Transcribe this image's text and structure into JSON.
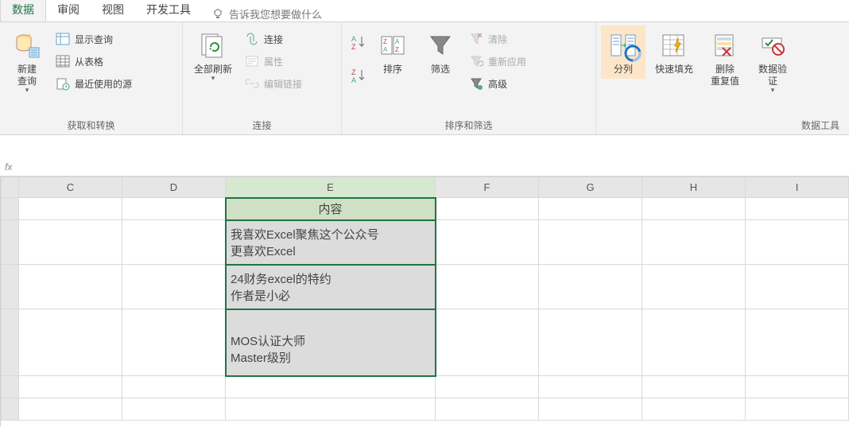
{
  "tabs": {
    "active": "数据",
    "items": [
      "数据",
      "审阅",
      "视图",
      "开发工具"
    ],
    "tellme": "告诉我您想要做什么"
  },
  "ribbon": {
    "group_get": {
      "label": "获取和转换",
      "new_query": "新建\n查询",
      "show_query": "显示查询",
      "from_table": "从表格",
      "recent": "最近使用的源"
    },
    "group_conn": {
      "label": "连接",
      "refresh_all": "全部刷新",
      "connections": "连接",
      "properties": "属性",
      "edit_links": "编辑链接"
    },
    "group_sort": {
      "label": "排序和筛选",
      "sort": "排序",
      "filter": "筛选",
      "clear": "清除",
      "reapply": "重新应用",
      "advanced": "高级"
    },
    "group_tools": {
      "label": "数据工具",
      "text_to_cols": "分列",
      "flash_fill": "快速填充",
      "remove_dup": "删除\n重复值",
      "data_valid": "数据验\n证"
    }
  },
  "grid": {
    "columns": [
      "C",
      "D",
      "E",
      "F",
      "G",
      "H",
      "I"
    ],
    "e_header": "内容",
    "e_rows": [
      "我喜欢Excel聚焦这个公众号\n更喜欢Excel",
      "24财务excel的特约\n作者是小必",
      "\nMOS认证大师\nMaster级别"
    ]
  }
}
